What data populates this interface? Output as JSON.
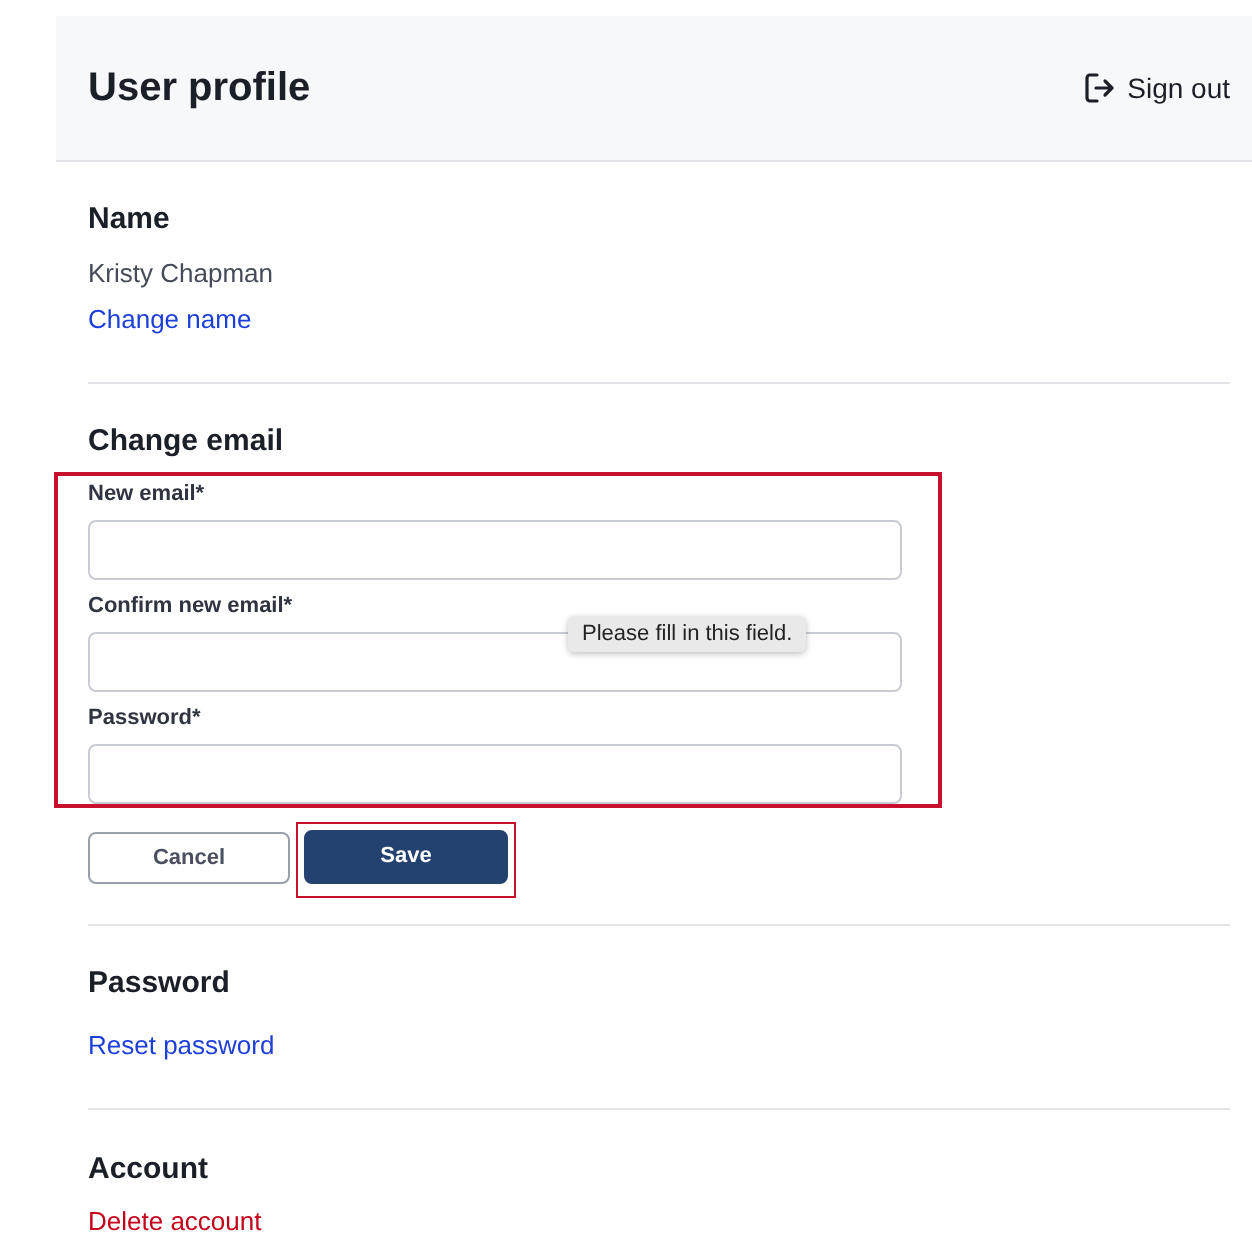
{
  "header": {
    "title": "User profile",
    "sign_out": "Sign out"
  },
  "sections": [
    {
      "kind": "info",
      "heading": "Name",
      "value": "Kristy Chapman",
      "link": {
        "text": "Change name",
        "kind": "info"
      }
    },
    {
      "kind": "form",
      "heading": "Change email",
      "highlighted": true,
      "fields": [
        {
          "label": "New email*"
        },
        {
          "label": "Confirm new email*",
          "tooltip": "Please fill in this field."
        },
        {
          "label": "Password*"
        }
      ],
      "buttons": [
        {
          "label": "Cancel",
          "kind": "secondary",
          "highlighted": false
        },
        {
          "label": "Save",
          "kind": "primary",
          "highlighted": true
        }
      ]
    },
    {
      "kind": "info",
      "heading": "Password",
      "link": {
        "text": "Reset password",
        "kind": "info"
      }
    },
    {
      "kind": "info",
      "heading": "Account",
      "link": {
        "text": "Delete account",
        "kind": "danger"
      }
    }
  ]
}
